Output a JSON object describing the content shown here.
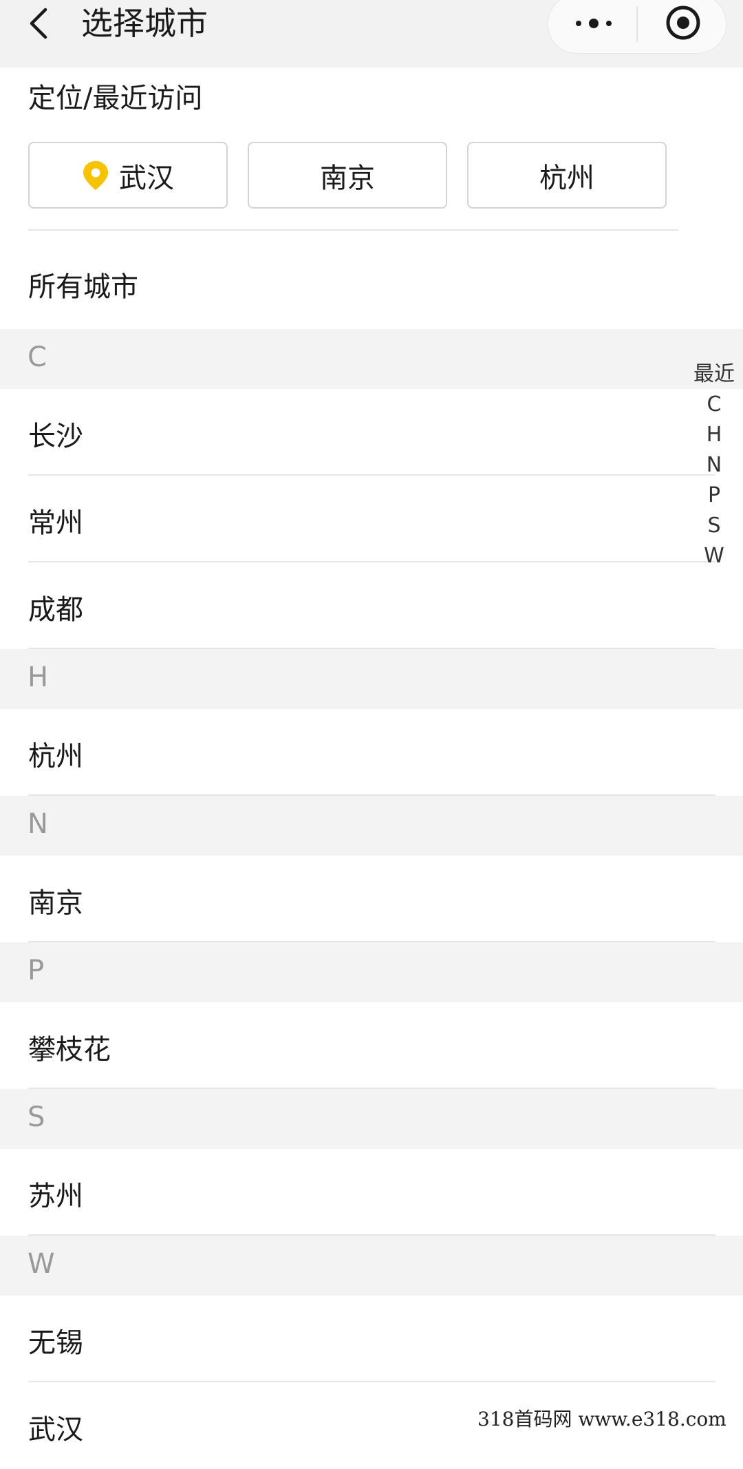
{
  "header": {
    "title": "选择城市"
  },
  "recent": {
    "label": "定位/最近访问",
    "items": [
      {
        "name": "武汉",
        "located": true
      },
      {
        "name": "南京",
        "located": false
      },
      {
        "name": "杭州",
        "located": false
      }
    ]
  },
  "all_cities": {
    "label": "所有城市",
    "groups": [
      {
        "letter": "C",
        "cities": [
          "长沙",
          "常州",
          "成都"
        ]
      },
      {
        "letter": "H",
        "cities": [
          "杭州"
        ]
      },
      {
        "letter": "N",
        "cities": [
          "南京"
        ]
      },
      {
        "letter": "P",
        "cities": [
          "攀枝花"
        ]
      },
      {
        "letter": "S",
        "cities": [
          "苏州"
        ]
      },
      {
        "letter": "W",
        "cities": [
          "无锡",
          "武汉"
        ]
      }
    ]
  },
  "index_bar": [
    "最近",
    "C",
    "H",
    "N",
    "P",
    "S",
    "W"
  ],
  "colors": {
    "accent": "#f7c300",
    "header_bg": "#f2f2f2",
    "group_bg": "#f3f3f3"
  },
  "watermark": "318首码网  www.e318.com"
}
